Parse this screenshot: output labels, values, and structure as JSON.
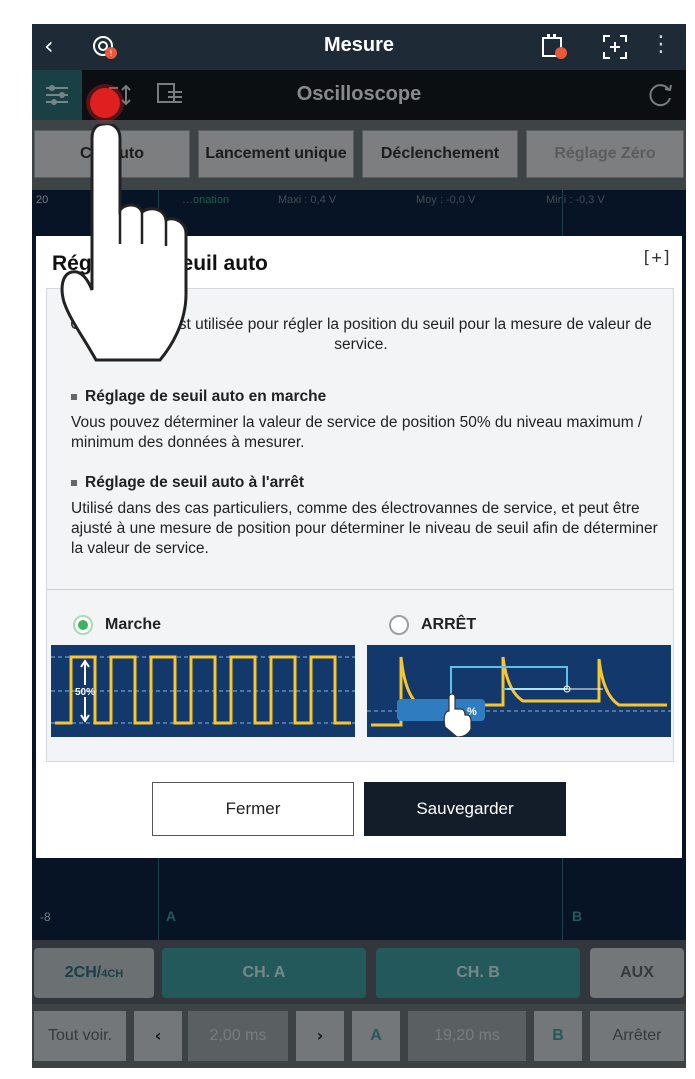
{
  "topbar": {
    "title": "Mesure",
    "icons": [
      "back-chevron-icon",
      "measure-settings-icon",
      "memory-icon",
      "expand-icon",
      "more-menu-icon"
    ]
  },
  "modebar": {
    "title": "Oscilloscope",
    "icons": [
      "channel-settings-icon",
      "trigger-level-icon",
      "save-list-icon",
      "refresh-icon"
    ]
  },
  "controls": {
    "ch_auto": "Ch. auto",
    "single": "Lancement unique",
    "trigger": "Déclenchement",
    "zero": "Réglage Zéro"
  },
  "scope": {
    "scale": "20",
    "mode": "…onation",
    "max": "Maxi : 0,4 V",
    "avg": "Moy : -0,0 V",
    "min": "Mini : -0,3 V",
    "offset": "-8",
    "marker_a": "A",
    "marker_b": "B"
  },
  "dialog": {
    "title": "Réglage de seuil auto",
    "intro": "Cette fonction est utilisée pour régler la position du seuil pour la mesure de valeur de service.",
    "section1_title": "Réglage de seuil auto en marche",
    "section1_text": "Vous pouvez déterminer la valeur de service de position 50% du niveau maximum / minimum des données à mesurer.",
    "section2_title": "Réglage de seuil auto à l'arrêt",
    "section2_text": "Utilisé dans des cas particuliers, comme des électrovannes de service, et peut être ajusté à une mesure de position pour déterminer le niveau de seuil afin de déterminer la valeur de service.",
    "option_on": "Marche",
    "option_off": "ARRÊT",
    "option_on_selected": true,
    "thumb_on_label": "50%",
    "thumb_off_label": "%",
    "close_label": "Fermer",
    "save_label": "Sauvegarder"
  },
  "bottom": {
    "channels": "2CH/",
    "channels_small": "4CH",
    "ch_a": "CH. A",
    "ch_b": "CH. B",
    "aux": "AUX",
    "view_all": "Tout voir.",
    "time_a": "2,00 ms",
    "cursor_a": "A",
    "time_b": "19,20 ms",
    "cursor_b": "B",
    "stop": "Arrêter"
  },
  "colors": {
    "accent": "#3d9a9e",
    "wave": "#f6c532",
    "scope_bg": "#13386c",
    "selected": "#3cb35e"
  }
}
